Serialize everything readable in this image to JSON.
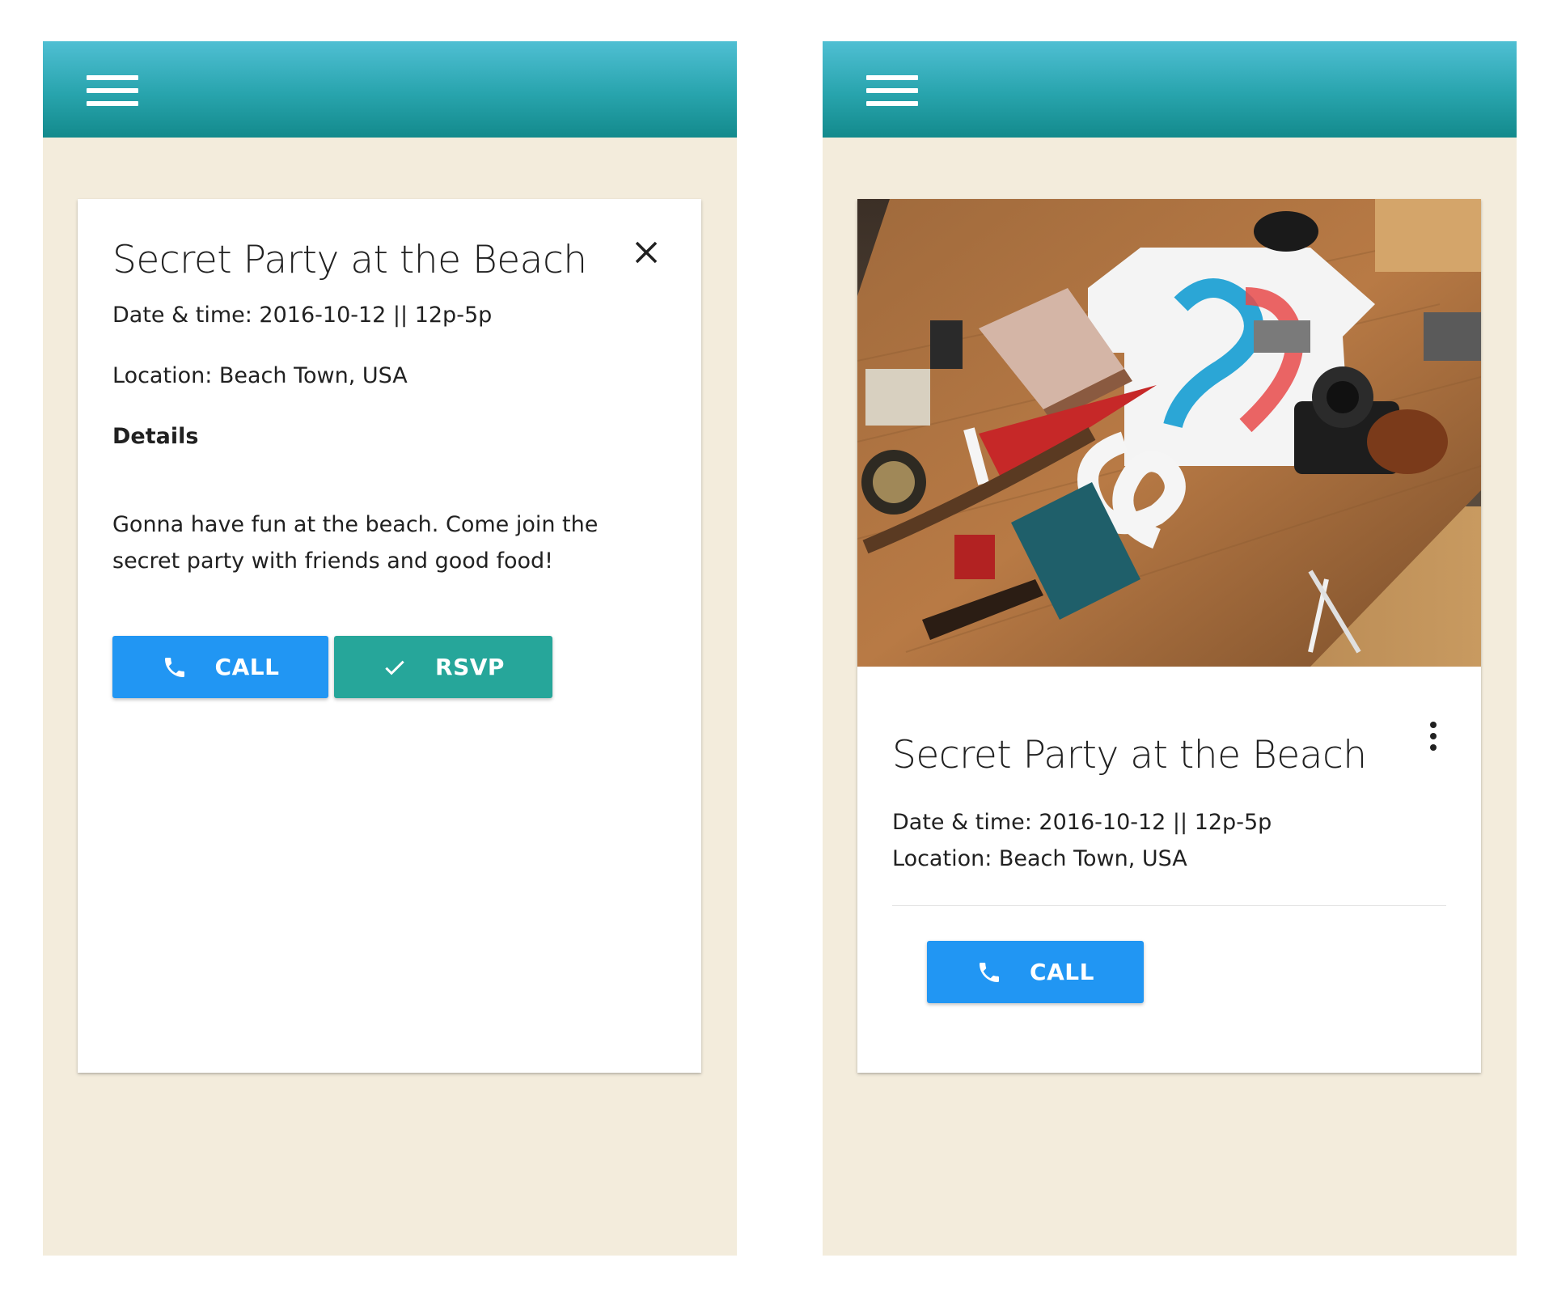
{
  "screens": {
    "left": {
      "appbar": {
        "menu_icon": "hamburger-menu-icon"
      },
      "card": {
        "title": "Secret Party at the Beach",
        "close_icon": "close-icon",
        "date_time": "Date & time: 2016-10-12 || 12p-5p",
        "location": "Location: Beach Town, USA",
        "details_heading": "Details",
        "description": "Gonna have fun at the beach. Come join the secret party with friends and good food!",
        "buttons": {
          "call": {
            "label": "CALL",
            "icon": "phone-icon"
          },
          "rsvp": {
            "label": "RSVP",
            "icon": "check-icon"
          }
        }
      }
    },
    "right": {
      "appbar": {
        "menu_icon": "hamburger-menu-icon"
      },
      "card": {
        "image": "event-hero-image",
        "title": "Secret Party at the Beach",
        "more_icon": "more-vert-icon",
        "date_time": "Date & time: 2016-10-12 || 12p-5p",
        "location": "Location: Beach Town, USA",
        "buttons": {
          "call": {
            "label": "CALL",
            "icon": "phone-icon"
          }
        }
      }
    }
  },
  "colors": {
    "appbar_gradient_top": "#4fbfd3",
    "appbar_gradient_bottom": "#138a8c",
    "page_background": "#f3ecdc",
    "card_background": "#ffffff",
    "call_button": "#2196f3",
    "rsvp_button": "#26a69a",
    "text": "#212121"
  }
}
